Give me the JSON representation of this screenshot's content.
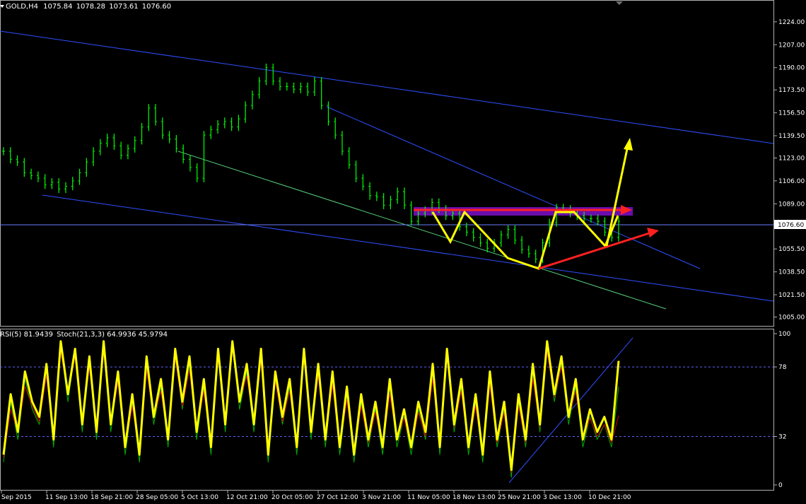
{
  "header": {
    "symbol": "GOLD,H4",
    "open": "1075.84",
    "high": "1078.28",
    "low": "1073.61",
    "close": "1076.60"
  },
  "indicator_header": {
    "rsi": "RSI(5) 81.9439",
    "stoch": "Stoch(21,3,3) 64.9936 45.9794"
  },
  "colors": {
    "background": "#000000",
    "candles": "#00ff00",
    "channel": "#2f4fff",
    "support": "#55d07a",
    "pattern": "#ffff00",
    "target": "#ff2020",
    "zone": "#6a0dad",
    "rsi": "#ffff00",
    "stoch_main": "#00b000",
    "stoch_signal": "#cc0000",
    "levels": "#6060ff"
  },
  "chart_data": [
    {
      "type": "bar",
      "title": "GOLD,H4",
      "price_axis_ticks": [
        "1224.00",
        "1207.00",
        "1190.00",
        "1173.50",
        "1156.50",
        "1139.50",
        "1123.00",
        "1106.00",
        "1089.00",
        "1072.00",
        "1055.50",
        "1038.50",
        "1021.50",
        "1005.00"
      ],
      "current_price_label": "1076.60",
      "ylim": [
        1000,
        1236
      ],
      "time_axis_ticks": [
        "Sep 2015",
        "11 Sep 13:00",
        "18 Sep 21:00",
        "28 Sep 05:00",
        "5 Oct 13:00",
        "12 Oct 21:00",
        "20 Oct 05:00",
        "27 Oct 12:00",
        "3 Nov 21:00",
        "11 Nov 05:00",
        "18 Nov 13:00",
        "25 Nov 21:00",
        "3 Dec 13:00",
        "10 Dec 21:00"
      ],
      "series": [
        {
          "values": [
            1128,
            1122,
            1120,
            1112,
            1110,
            1108,
            1103,
            1105,
            1100,
            1102,
            1106,
            1112,
            1120,
            1128,
            1134,
            1138,
            1132,
            1125,
            1130,
            1136,
            1146,
            1160,
            1150,
            1140,
            1137,
            1130,
            1122,
            1116,
            1108,
            1140,
            1144,
            1148,
            1150,
            1146,
            1152,
            1162,
            1170,
            1180,
            1190,
            1180,
            1176,
            1176,
            1174,
            1176,
            1172,
            1180,
            1162,
            1150,
            1140,
            1128,
            1118,
            1108,
            1102,
            1095,
            1094,
            1088,
            1092,
            1098,
            1088,
            1076,
            1082,
            1084,
            1090,
            1085,
            1080,
            1082,
            1072,
            1068,
            1064,
            1060,
            1056,
            1060,
            1066,
            1070,
            1062,
            1055,
            1052,
            1048,
            1060,
            1075,
            1086,
            1085,
            1082,
            1080,
            1078,
            1078,
            1076,
            1068,
            1064,
            1076
          ]
        }
      ]
    },
    {
      "type": "line",
      "title": "RSI(5) 81.9439 Stoch(21,3,3) 64.9936 45.9794",
      "y_axis_ticks": [
        "100",
        "78",
        "32",
        "0"
      ],
      "levels": [
        78,
        32
      ],
      "ylim": [
        0,
        100
      ],
      "series": [
        {
          "name": "RSI(5)",
          "values": [
            20,
            60,
            35,
            75,
            55,
            45,
            80,
            30,
            95,
            60,
            90,
            40,
            85,
            35,
            95,
            40,
            75,
            25,
            60,
            20,
            85,
            45,
            70,
            30,
            90,
            55,
            85,
            35,
            70,
            25,
            90,
            40,
            95,
            55,
            80,
            40,
            90,
            20,
            75,
            45,
            70,
            25,
            90,
            35,
            80,
            30,
            75,
            25,
            65,
            20,
            60,
            30,
            55,
            25,
            70,
            30,
            50,
            25,
            55,
            35,
            80,
            25,
            90,
            40,
            70,
            25,
            60,
            20,
            75,
            30,
            55,
            10,
            60,
            30,
            80,
            40,
            95,
            60,
            85,
            45,
            70,
            30,
            50,
            35,
            45,
            30,
            82
          ]
        },
        {
          "name": "Stoch main",
          "values": [
            15,
            55,
            30,
            70,
            50,
            40,
            78,
            25,
            92,
            55,
            88,
            35,
            80,
            30,
            92,
            35,
            72,
            20,
            55,
            15,
            80,
            40,
            65,
            25,
            88,
            50,
            80,
            30,
            65,
            20,
            88,
            35,
            92,
            50,
            75,
            35,
            85,
            15,
            70,
            40,
            65,
            20,
            88,
            30,
            75,
            25,
            70,
            20,
            60,
            15,
            55,
            25,
            50,
            20,
            65,
            25,
            45,
            20,
            50,
            30,
            75,
            20,
            88,
            35,
            65,
            20,
            55,
            15,
            70,
            25,
            50,
            5,
            55,
            25,
            75,
            35,
            92,
            55,
            80,
            40,
            65,
            25,
            45,
            30,
            40,
            25,
            65
          ]
        },
        {
          "name": "Stoch signal",
          "values": [
            18,
            50,
            35,
            65,
            52,
            42,
            72,
            30,
            88,
            60,
            85,
            40,
            78,
            35,
            88,
            40,
            68,
            25,
            52,
            20,
            76,
            44,
            62,
            30,
            84,
            52,
            76,
            35,
            62,
            25,
            84,
            40,
            90,
            55,
            72,
            40,
            82,
            20,
            68,
            42,
            62,
            25,
            84,
            35,
            72,
            30,
            66,
            25,
            56,
            20,
            52,
            28,
            48,
            24,
            60,
            30,
            44,
            24,
            48,
            32,
            70,
            26,
            84,
            38,
            62,
            24,
            52,
            20,
            66,
            28,
            48,
            8,
            52,
            28,
            70,
            38,
            88,
            58,
            78,
            44,
            62,
            30,
            44,
            32,
            40,
            28,
            46
          ]
        }
      ]
    }
  ]
}
